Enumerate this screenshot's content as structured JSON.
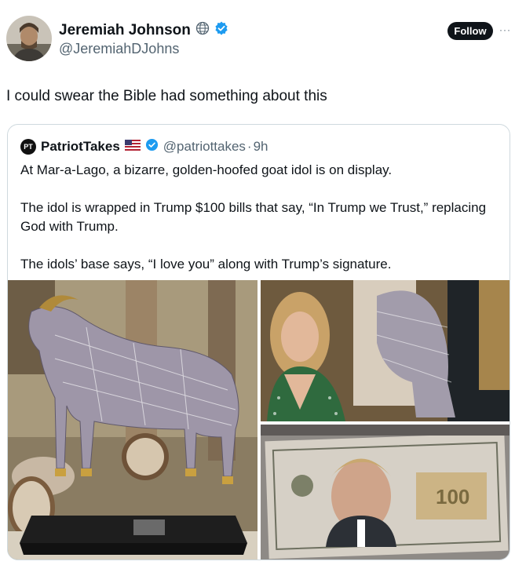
{
  "author": {
    "name": "Jeremiah Johnson",
    "handle": "@JeremiahDJohns",
    "badges": [
      "globe-icon",
      "verified-badge-icon"
    ]
  },
  "actions": {
    "follow_label": "Follow",
    "more_label": "···"
  },
  "tweet": {
    "text": "I could swear the Bible had something about this"
  },
  "quoted": {
    "avatar_label": "PT",
    "name": "PatriotTakes",
    "flag": "us-flag-icon",
    "handle": "@patriottakes",
    "separator": "·",
    "time": "9h",
    "paragraphs": [
      "At Mar-a-Lago, a bizarre, golden-hoofed goat idol is on display.",
      "The idol is wrapped in Trump $100 bills that say, “In Trump we Trust,” replacing God with Trump.",
      "The idols’ base says, “I love you” along with Trump’s signature."
    ]
  },
  "colors": {
    "text": "#0f1419",
    "secondary": "#536471",
    "verified": "#1d9bf0",
    "border": "#cfd9de"
  }
}
